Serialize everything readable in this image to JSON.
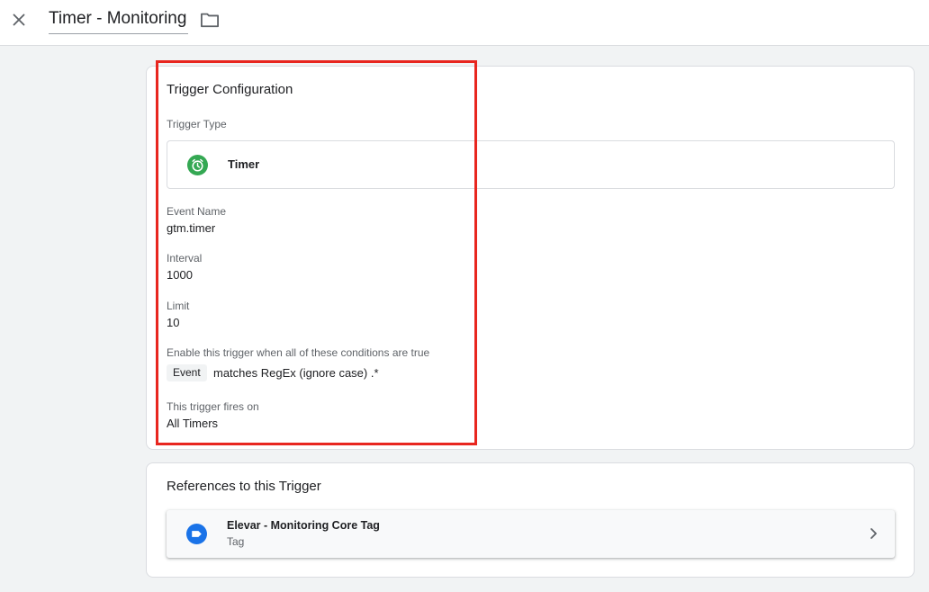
{
  "header": {
    "title": "Timer - Monitoring"
  },
  "config": {
    "card_title": "Trigger Configuration",
    "trigger_type_label": "Trigger Type",
    "trigger_type": "Timer",
    "fields": [
      {
        "label": "Event Name",
        "value": "gtm.timer"
      },
      {
        "label": "Interval",
        "value": "1000"
      },
      {
        "label": "Limit",
        "value": "10"
      }
    ],
    "conditions_label": "Enable this trigger when all of these conditions are true",
    "condition": {
      "variable": "Event",
      "operator_value": "matches RegEx (ignore case) .*"
    },
    "fires_on_label": "This trigger fires on",
    "fires_on": "All Timers"
  },
  "references": {
    "card_title": "References to this Trigger",
    "items": [
      {
        "name": "Elevar - Monitoring Core Tag",
        "type": "Tag"
      }
    ]
  },
  "colors": {
    "highlight": "#e8261f",
    "timer_icon": "#34a853",
    "tag_icon": "#1a73e8"
  },
  "icons": {
    "close": "close-icon",
    "folder": "folder-icon",
    "trigger_type": "timer-icon",
    "reference": "tag-icon",
    "navigate": "chevron-right-icon"
  }
}
